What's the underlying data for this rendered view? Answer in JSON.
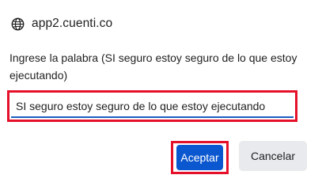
{
  "dialog": {
    "site": "app2.cuenti.co",
    "site_icon": "globe-icon",
    "message": "Ingrese la palabra (SI seguro estoy seguro de lo que estoy ejecutando)",
    "input_value": "SI seguro estoy seguro de lo que estoy ejecutando",
    "accept_label": "Aceptar",
    "cancel_label": "Cancelar"
  },
  "colors": {
    "accent": "#0b57d0",
    "highlight": "#e5102a",
    "cancel_bg": "#e8eaed"
  }
}
